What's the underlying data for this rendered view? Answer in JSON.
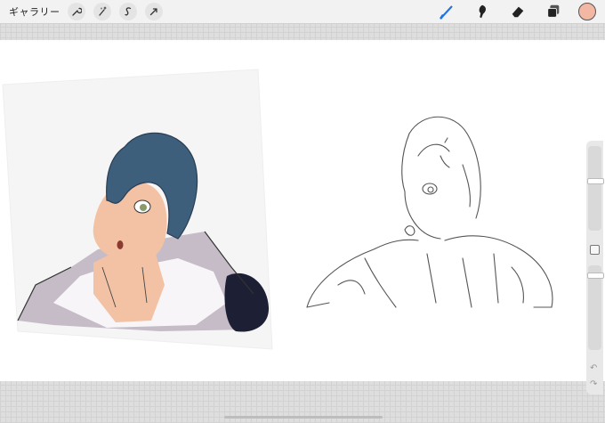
{
  "topbar": {
    "gallery_label": "ギャラリー",
    "left_tools": [
      "wrench-icon",
      "magic-wand-icon",
      "selection-icon",
      "transform-arrow-icon"
    ],
    "right_tools": [
      "brush-icon",
      "smudge-icon",
      "eraser-icon",
      "layers-icon"
    ],
    "current_color": "#f2b8a3",
    "accent_color": "#1f72e8"
  },
  "sidebar": {
    "undo_label": "↶",
    "redo_label": "↷"
  },
  "artwork": {
    "colored_panel_bg": "#f5f5f5",
    "hair_color": "#3e5f7c",
    "skin_color": "#f3c2a4",
    "shirt_color": "#c3b9c4",
    "dark_blob_color": "#1d2034"
  }
}
